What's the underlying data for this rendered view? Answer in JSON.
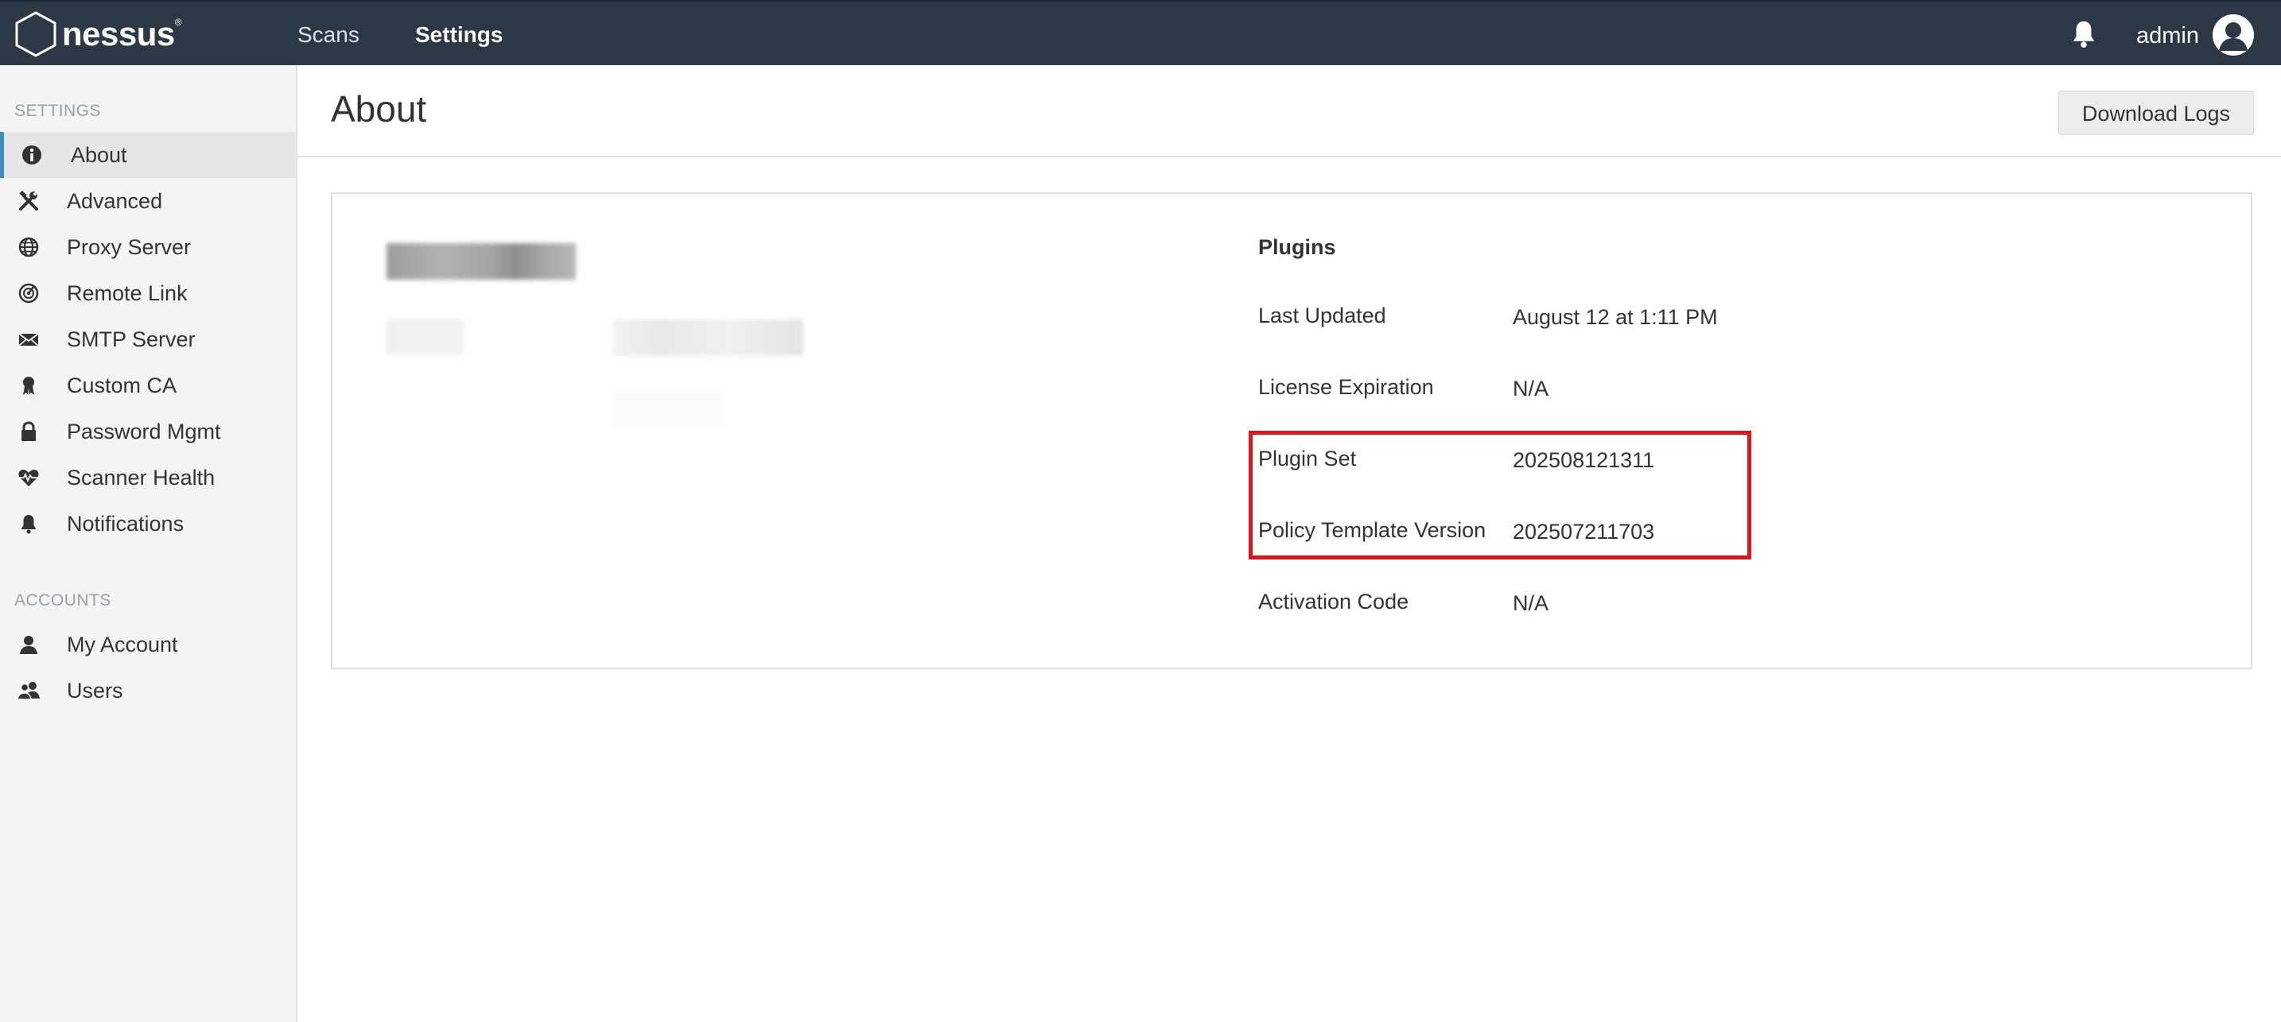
{
  "topbar": {
    "logo_text": "nessus",
    "nav": [
      {
        "label": "Scans",
        "active": false
      },
      {
        "label": "Settings",
        "active": true
      }
    ],
    "user": "admin",
    "icons": {
      "bell": "bell-icon",
      "avatar": "user-avatar-icon"
    }
  },
  "sidebar": {
    "settings_header": "SETTINGS",
    "settings_items": [
      {
        "label": "About",
        "icon": "info-circle-icon",
        "active": true
      },
      {
        "label": "Advanced",
        "icon": "tools-icon",
        "active": false
      },
      {
        "label": "Proxy Server",
        "icon": "globe-icon",
        "active": false
      },
      {
        "label": "Remote Link",
        "icon": "link-icon",
        "active": false
      },
      {
        "label": "SMTP Server",
        "icon": "envelope-icon",
        "active": false
      },
      {
        "label": "Custom CA",
        "icon": "ribbon-icon",
        "active": false
      },
      {
        "label": "Password Mgmt",
        "icon": "lock-icon",
        "active": false
      },
      {
        "label": "Scanner Health",
        "icon": "heartbeat-icon",
        "active": false
      },
      {
        "label": "Notifications",
        "icon": "bell-icon",
        "active": false
      }
    ],
    "accounts_header": "ACCOUNTS",
    "accounts_items": [
      {
        "label": "My Account",
        "icon": "user-icon",
        "active": false
      },
      {
        "label": "Users",
        "icon": "users-icon",
        "active": false
      }
    ]
  },
  "page": {
    "title": "About",
    "download_logs_label": "Download Logs"
  },
  "plugins": {
    "title": "Plugins",
    "rows": [
      {
        "label": "Last Updated",
        "value": "August 12 at 1:11 PM"
      },
      {
        "label": "License Expiration",
        "value": "N/A"
      },
      {
        "label": "Plugin Set",
        "value": "202508121311"
      },
      {
        "label": "Policy Template Version",
        "value": "202507211703"
      },
      {
        "label": "Activation Code",
        "value": "N/A"
      }
    ]
  },
  "colors": {
    "topbar": "#2c3846",
    "sidebar": "#f4f4f4",
    "active_accent": "#3b8ac4",
    "highlight": "#e0141c"
  }
}
